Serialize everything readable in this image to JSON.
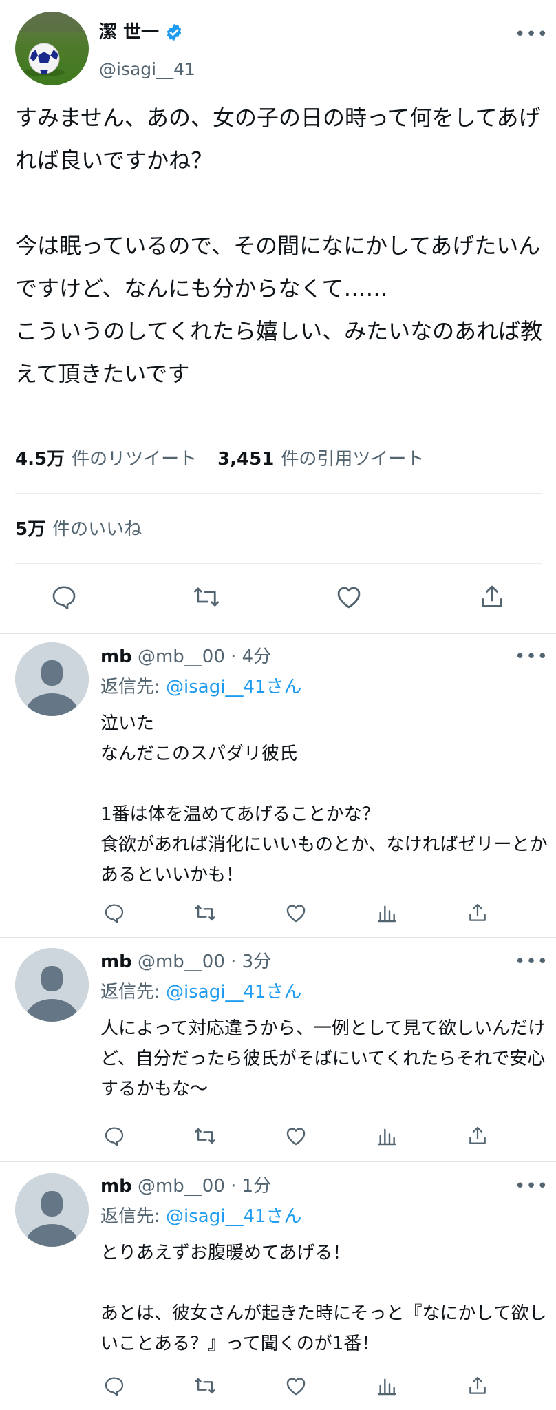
{
  "main_tweet": {
    "display_name": "潔 世一",
    "handle": "@isagi__41",
    "text": "すみません、あの、女の子の日の時って何をしてあげれば良いですかね？\n\n今は眠っているので、その間になにかしてあげたいんですけど、なんにも分からなくて……\nこういうのしてくれたら嬉しい、みたいなのあれば教えて頂きたいです",
    "retweets_count": "4.5万",
    "retweets_label": "件のリツイート",
    "quotes_count": "3,451",
    "quotes_label": "件の引用ツイート",
    "likes_count": "5万",
    "likes_label": "件のいいね",
    "actions": [
      "reply-icon",
      "retweet-icon",
      "like-icon",
      "share-icon"
    ]
  },
  "replies": [
    {
      "display_name": "mb",
      "handle": "@mb__00",
      "time": "· 4分",
      "reply_prefix": "返信先: ",
      "reply_to": "@isagi__41さん",
      "text": "泣いた\nなんだこのスパダリ彼氏\n\n1番は体を温めてあげることかな？\n食欲があれば消化にいいものとか、なければゼリーとかあるといいかも！"
    },
    {
      "display_name": "mb",
      "handle": "@mb__00",
      "time": "· 3分",
      "reply_prefix": "返信先: ",
      "reply_to": "@isagi__41さん",
      "text": "人によって対応違うから、一例として見て欲しいんだけど、自分だったら彼氏がそばにいてくれたらそれで安心するかもな〜"
    },
    {
      "display_name": "mb",
      "handle": "@mb__00",
      "time": "· 1分",
      "reply_prefix": "返信先: ",
      "reply_to": "@isagi__41さん",
      "text": "とりあえずお腹暖めてあげる！\n\nあとは、彼女さんが起きた時にそっと『なにかして欲しいことある？』って聞くのが1番！"
    }
  ],
  "colors": {
    "text": "#0f1419",
    "secondary": "#536471",
    "link": "#1d9bf0",
    "divider": "#e6ecf0",
    "avatar_placeholder": "#ccd6dc"
  }
}
